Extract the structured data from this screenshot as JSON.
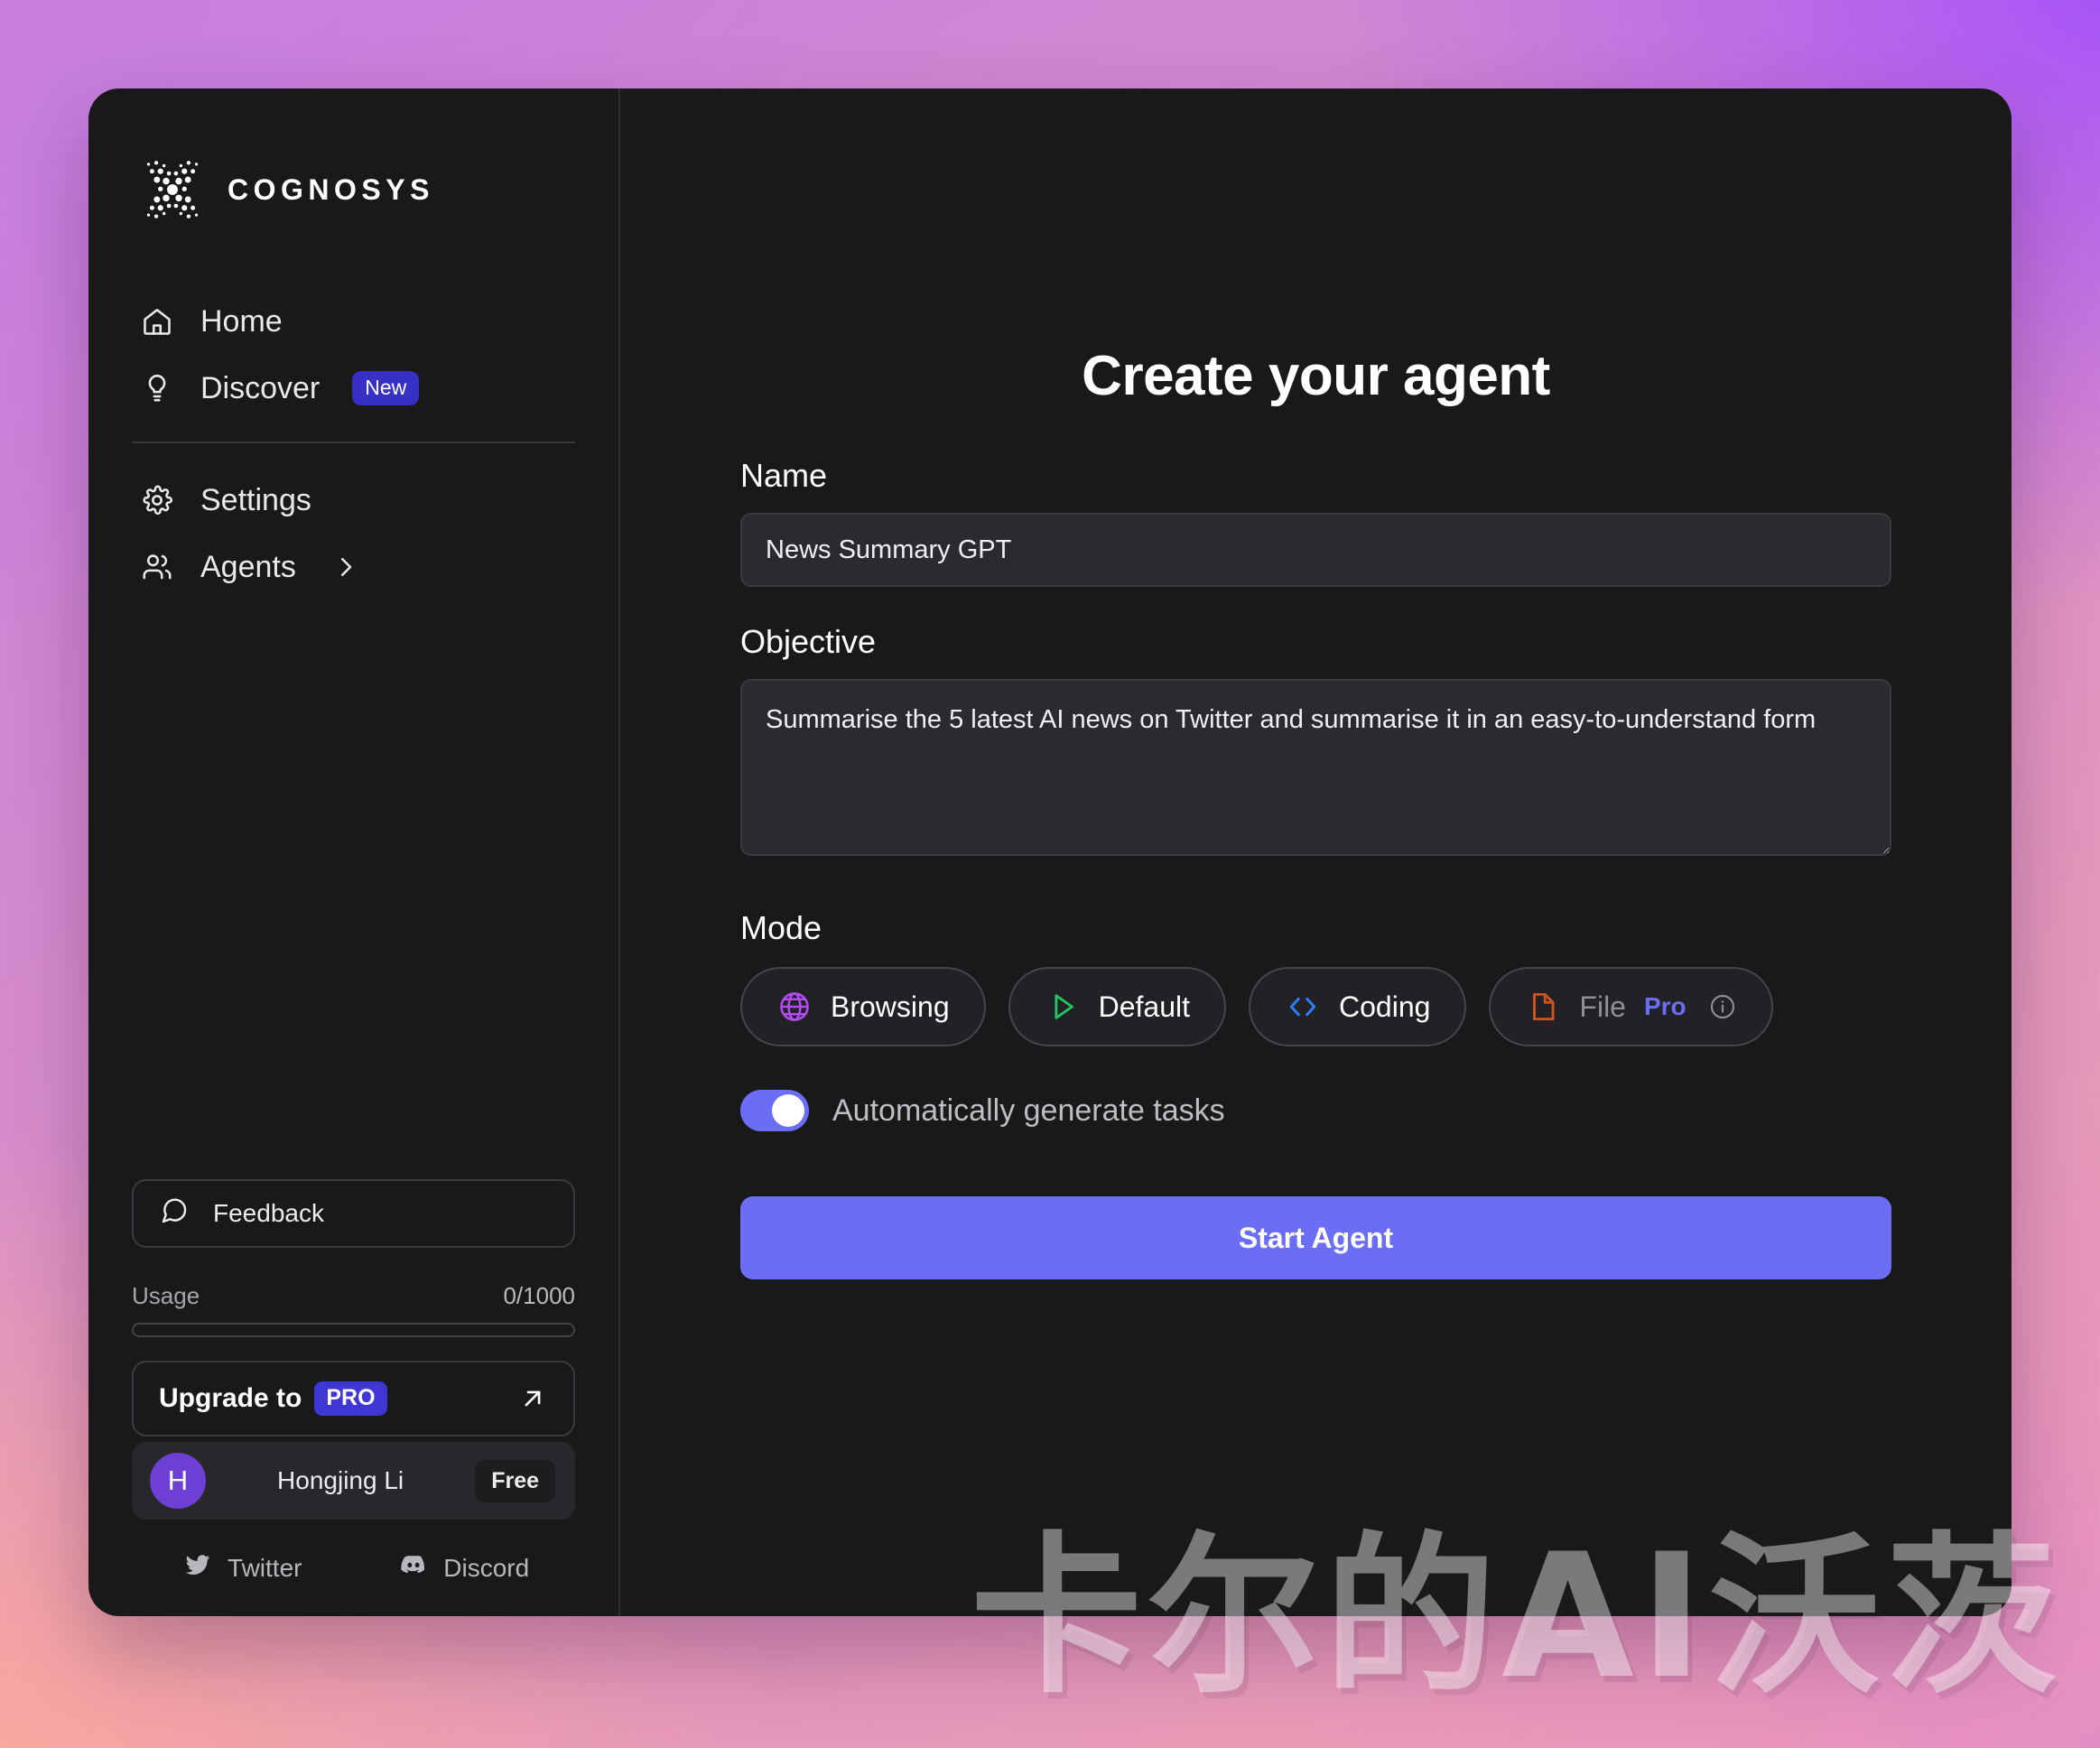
{
  "brand": {
    "name": "COGNOSYS",
    "mark_icon": "cognosys-dot-x-logo"
  },
  "sidebar": {
    "nav_primary": [
      {
        "label": "Home",
        "icon": "home-icon",
        "badge": null
      },
      {
        "label": "Discover",
        "icon": "lightbulb-icon",
        "badge": "New"
      }
    ],
    "nav_secondary": [
      {
        "label": "Settings",
        "icon": "gear-icon",
        "chevron": false
      },
      {
        "label": "Agents",
        "icon": "users-icon",
        "chevron": true
      }
    ],
    "feedback": {
      "label": "Feedback",
      "icon": "message-circle-icon"
    },
    "usage": {
      "label": "Usage",
      "amount": "0/1000",
      "percent": 0
    },
    "upgrade": {
      "label": "Upgrade to",
      "badge": "PRO",
      "icon": "arrow-up-right-icon"
    },
    "account": {
      "avatar_initial": "H",
      "name": "Hongjing Li",
      "plan_badge": "Free"
    },
    "social": [
      {
        "label": "Twitter",
        "icon": "twitter-icon"
      },
      {
        "label": "Discord",
        "icon": "discord-icon"
      }
    ]
  },
  "main": {
    "title": "Create your agent",
    "name_field": {
      "label": "Name",
      "value": "News Summary GPT",
      "placeholder": "Name"
    },
    "objective_field": {
      "label": "Objective",
      "value": "Summarise the 5 latest AI news on Twitter and summarise it in an easy-to-understand form",
      "placeholder": "Objective"
    },
    "mode": {
      "label": "Mode",
      "options": [
        {
          "label": "Browsing",
          "icon": "globe-icon",
          "icon_color": "#b44bf0",
          "pro": null,
          "info": false,
          "dim": false
        },
        {
          "label": "Default",
          "icon": "play-triangle-icon",
          "icon_color": "#22c55e",
          "pro": null,
          "info": false,
          "dim": false
        },
        {
          "label": "Coding",
          "icon": "code-brackets-icon",
          "icon_color": "#2d7ff9",
          "pro": null,
          "info": false,
          "dim": false
        },
        {
          "label": "File",
          "icon": "file-icon",
          "icon_color": "#d1541f",
          "pro": "Pro",
          "info": true,
          "dim": true
        }
      ]
    },
    "auto_tasks": {
      "label": "Automatically generate tasks",
      "enabled": true
    },
    "start_button": "Start Agent"
  },
  "watermark": {
    "text": "卡尔的AI沃茨"
  },
  "colors": {
    "accent": "#6b6ef5",
    "badge_new": "#3730c4",
    "badge_pro": "#3f36d6",
    "avatar": "#6d3fd4",
    "card_bg": "#191919",
    "input_bg": "#2a2b2f"
  }
}
